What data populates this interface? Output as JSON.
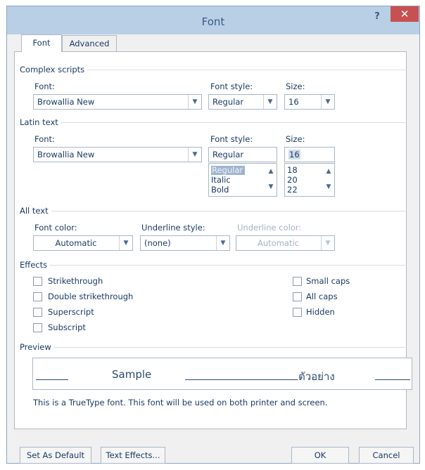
{
  "window": {
    "title": "Font",
    "help_label": "?",
    "close_label": "✕"
  },
  "tabs": {
    "font": "Font",
    "advanced": "Advanced"
  },
  "complex": {
    "heading": "Complex scripts",
    "font_label": "Font:",
    "style_label": "Font style:",
    "size_label": "Size:",
    "font_value": "Browallia New",
    "style_value": "Regular",
    "size_value": "16"
  },
  "latin": {
    "heading": "Latin text",
    "font_label": "Font:",
    "style_label": "Font style:",
    "size_label": "Size:",
    "font_value": "Browallia New",
    "style_value": "Regular",
    "size_value": "16",
    "style_list": [
      "Regular",
      "Italic",
      "Bold"
    ],
    "size_list": [
      "18",
      "20",
      "22"
    ]
  },
  "alltext": {
    "heading": "All text",
    "color_label": "Font color:",
    "color_value": "Automatic",
    "underline_label": "Underline style:",
    "underline_value": "(none)",
    "ucolor_label": "Underline color:",
    "ucolor_value": "Automatic"
  },
  "effects": {
    "heading": "Effects",
    "strikethrough": "Strikethrough",
    "double_strikethrough": "Double strikethrough",
    "superscript": "Superscript",
    "subscript": "Subscript",
    "small_caps": "Small caps",
    "all_caps": "All caps",
    "hidden": "Hidden"
  },
  "preview": {
    "heading": "Preview",
    "sample_latin": "Sample",
    "sample_complex": "ตัวอย่าง",
    "note": "This is a TrueType font. This font will be used on both printer and screen."
  },
  "buttons": {
    "set_default": "Set As Default",
    "text_effects": "Text Effects...",
    "ok": "OK",
    "cancel": "Cancel"
  },
  "icons": {
    "dropdown": "chevron-down-icon",
    "scroll_up": "chevron-up-icon"
  },
  "colors": {
    "titlebar": "#b9cfe6",
    "close": "#c75050",
    "text": "#1a3a66"
  }
}
